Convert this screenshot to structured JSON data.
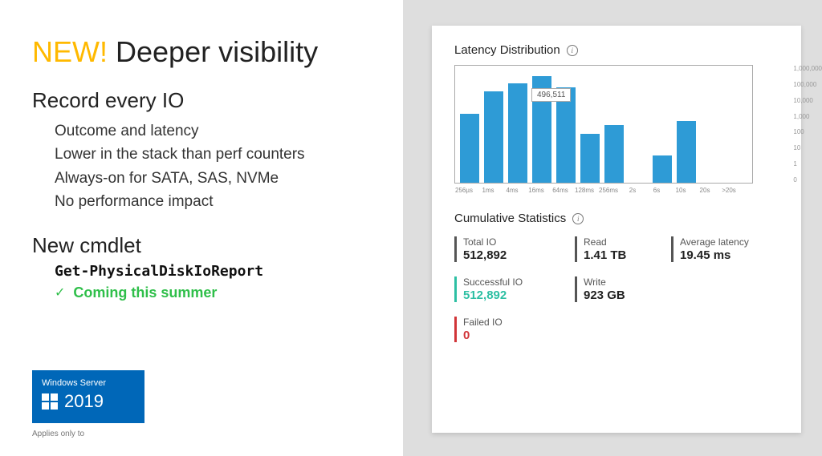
{
  "title": {
    "new": "NEW!",
    "rest": " Deeper visibility"
  },
  "section1": {
    "heading": "Record every IO",
    "items": [
      "Outcome and latency",
      "Lower in the stack than perf counters",
      "Always-on for SATA, SAS, NVMe",
      "No performance impact"
    ]
  },
  "section2": {
    "heading": "New cmdlet",
    "cmdlet": "Get-PhysicalDiskIoReport",
    "check": "✓",
    "coming": "Coming this summer"
  },
  "badge": {
    "product": "Windows Server",
    "year": "2019",
    "applies": "Applies only to"
  },
  "panel": {
    "latency_title": "Latency Distribution",
    "tooltip": "496,511",
    "cumulative_title": "Cumulative Statistics",
    "stats": {
      "total_io": {
        "label": "Total IO",
        "value": "512,892"
      },
      "read": {
        "label": "Read",
        "value": "1.41 TB"
      },
      "avg_latency": {
        "label": "Average latency",
        "value": "19.45 ms"
      },
      "success_io": {
        "label": "Successful IO",
        "value": "512,892"
      },
      "write": {
        "label": "Write",
        "value": "923 GB"
      },
      "failed_io": {
        "label": "Failed IO",
        "value": "0"
      }
    }
  },
  "chart_data": {
    "type": "bar",
    "title": "Latency Distribution",
    "xlabel": "",
    "ylabel": "",
    "yscale": "log",
    "ylim": [
      0,
      1000000
    ],
    "yticks": [
      "1,000,000",
      "100,000",
      "10,000",
      "1,000",
      "100",
      "10",
      "1",
      "0"
    ],
    "categories": [
      "256µs",
      "1ms",
      "4ms",
      "16ms",
      "64ms",
      "128ms",
      "256ms",
      "2s",
      "6s",
      "10s",
      "20s",
      ">20s"
    ],
    "values": [
      5000,
      80000,
      200000,
      496511,
      130000,
      400,
      1200,
      0,
      30,
      2000,
      0,
      0
    ],
    "tooltip": {
      "category": "16ms",
      "value": 496511
    }
  }
}
